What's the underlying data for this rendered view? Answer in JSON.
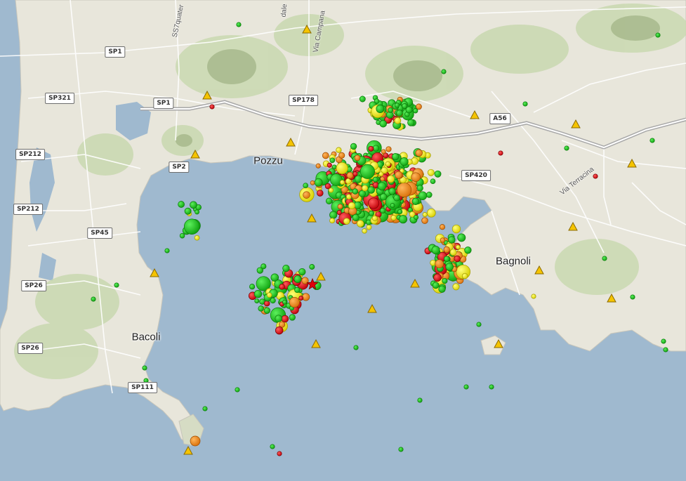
{
  "colors": {
    "sea": "#9fb9cf",
    "land": "#e8e6db",
    "green_land": "#c9d8b0",
    "crater": "#9fb283",
    "road": "#ffffff",
    "motorway": "#a8a8a8",
    "quake_green": "#18c418",
    "quake_yellow": "#f1e800",
    "quake_orange": "#ef8a12",
    "quake_red": "#e0000b",
    "station": "#f5c400"
  },
  "icons": {
    "station": "yellow-triangle-icon",
    "epicenter": "red-star-icon",
    "event": "circle-marker"
  },
  "road_labels": [
    {
      "id": "sp1-north",
      "text": "SP1"
    },
    {
      "id": "sp321",
      "text": "SP321"
    },
    {
      "id": "sp1-south",
      "text": "SP1"
    },
    {
      "id": "sp178",
      "text": "SP178"
    },
    {
      "id": "a56",
      "text": "A56"
    },
    {
      "id": "sp212-north",
      "text": "SP212"
    },
    {
      "id": "sp2",
      "text": "SP2"
    },
    {
      "id": "sp420",
      "text": "SP420"
    },
    {
      "id": "sp212-south",
      "text": "SP212"
    },
    {
      "id": "sp45",
      "text": "SP45"
    },
    {
      "id": "sp26-north",
      "text": "SP26"
    },
    {
      "id": "sp26-south",
      "text": "SP26"
    },
    {
      "id": "sp111",
      "text": "SP111"
    }
  ],
  "place_labels": [
    {
      "id": "pozzuoli",
      "text": "Pozzu"
    },
    {
      "id": "bagnoli",
      "text": "Bagnoli"
    },
    {
      "id": "bacoli",
      "text": "Bacoli"
    }
  ],
  "street_labels": [
    {
      "id": "via-campana",
      "text": "Via Campana"
    },
    {
      "id": "ss7-quater",
      "text": "SS7quater"
    },
    {
      "id": "via-terracina",
      "text": "Via Terracina"
    },
    {
      "id": "dale",
      "text": "dale"
    }
  ]
}
